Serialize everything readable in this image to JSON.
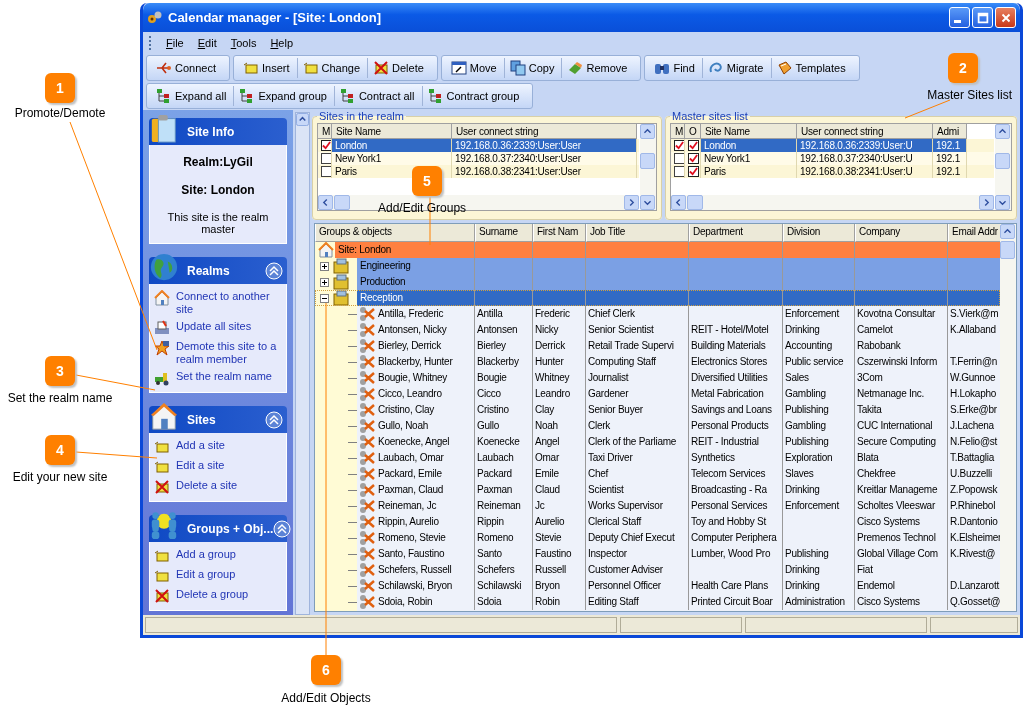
{
  "window": {
    "title": "Calendar manager - [Site: London]"
  },
  "menu": [
    "File",
    "Edit",
    "Tools",
    "Help"
  ],
  "toolbar_rows": [
    {
      "groups": [
        {
          "buttons": [
            "Connect"
          ]
        },
        {
          "buttons": [
            "Insert",
            "Change",
            "Delete"
          ]
        },
        {
          "buttons": [
            "Move",
            "Copy",
            "Remove"
          ]
        },
        {
          "buttons": [
            "Find",
            "Migrate",
            "Templates"
          ]
        }
      ]
    },
    {
      "groups": [
        {
          "buttons": [
            "Expand all",
            "Expand group",
            "Contract all",
            "Contract group"
          ]
        }
      ]
    }
  ],
  "task_pane": {
    "sections": [
      {
        "title": "Site Info",
        "kind": "info",
        "lines": [
          {
            "text": "Realm:LyGil",
            "kind": "bold"
          },
          {
            "text": "Site: London",
            "kind": "bold"
          },
          {
            "text": "This site is the realm master",
            "kind": "plain"
          }
        ]
      },
      {
        "title": "Realms",
        "kind": "links",
        "expanded": true,
        "links": [
          "Connect to another site",
          "Update all sites",
          "Demote this site to a realm member",
          "Set the realm name"
        ]
      },
      {
        "title": "Sites",
        "kind": "links",
        "expanded": true,
        "links": [
          "Add a site",
          "Edit a site",
          "Delete a site"
        ]
      },
      {
        "title": "Groups + Obj...",
        "kind": "links",
        "expanded": true,
        "links": [
          "Add a group",
          "Edit a group",
          "Delete a group"
        ]
      }
    ]
  },
  "sites_in_realm": {
    "title": "Sites in the realm",
    "columns": [
      "M",
      "Site Name",
      "User connect string"
    ],
    "rows": [
      {
        "master": true,
        "selected": true,
        "cells": [
          "",
          "London",
          "192.168.0.36:2339:User:User"
        ]
      },
      {
        "master": false,
        "selected": false,
        "cells": [
          "",
          "New York1",
          "192.168.0.37:2340:User:User"
        ]
      },
      {
        "master": false,
        "selected": false,
        "cells": [
          "",
          "Paris",
          "192.168.0.38:2341:User:User"
        ]
      }
    ]
  },
  "master_sites": {
    "title": "Master sites list",
    "columns": [
      "M",
      "O",
      "Site Name",
      "User connect string",
      "Admi"
    ],
    "rows": [
      {
        "m_checked": true,
        "o_checked": true,
        "selected": true,
        "cells": [
          "",
          "",
          "London",
          "192.168.0.36:2339:User:U",
          "192.1"
        ]
      },
      {
        "m_checked": false,
        "o_checked": true,
        "selected": false,
        "cells": [
          "",
          "",
          "New York1",
          "192.168.0.37:2340:User:U",
          "192.1"
        ]
      },
      {
        "m_checked": false,
        "o_checked": true,
        "selected": false,
        "cells": [
          "",
          "",
          "Paris",
          "192.168.0.38:2341:User:U",
          "192.1"
        ]
      }
    ]
  },
  "grid": {
    "columns": [
      "Groups & objects",
      "Surname",
      "First Nam",
      "Job Title",
      "Department",
      "Division",
      "Company",
      "Email Addr"
    ],
    "tree": {
      "label": "Site: London",
      "children": [
        {
          "label": "Engineering",
          "expanded": false,
          "selected": false
        },
        {
          "label": "Production",
          "expanded": false,
          "selected": false
        },
        {
          "label": "Reception",
          "expanded": true,
          "selected": true,
          "children": [
            {
              "label": "Antilla, Frederic",
              "cells": [
                "Antilla",
                "Frederic",
                "Chief Clerk",
                "",
                "Enforcement",
                "Kovotna Consultar",
                "S.Vierk@m"
              ]
            },
            {
              "label": "Antonsen, Nicky",
              "cells": [
                "Antonsen",
                "Nicky",
                "Senior Scientist",
                "REIT - Hotel/Motel",
                "Drinking",
                "Camelot",
                "K.Allaband"
              ]
            },
            {
              "label": "Bierley, Derrick",
              "cells": [
                "Bierley",
                "Derrick",
                "Retail Trade Supervi",
                "Building Materials",
                "Accounting",
                "Rabobank",
                ""
              ]
            },
            {
              "label": "Blackerby, Hunter",
              "cells": [
                "Blackerby",
                "Hunter",
                "Computing Staff",
                "Electronics Stores",
                "Public service",
                "Cszerwinski Inform",
                "T.Ferrin@n"
              ]
            },
            {
              "label": "Bougie, Whitney",
              "cells": [
                "Bougie",
                "Whitney",
                "Journalist",
                "Diversified Utilities",
                "Sales",
                "3Com",
                "W.Gunnoe"
              ]
            },
            {
              "label": "Cicco, Leandro",
              "cells": [
                "Cicco",
                "Leandro",
                "Gardener",
                "Metal Fabrication",
                "Gambling",
                "Netmanage Inc.",
                "H.Lokapho"
              ]
            },
            {
              "label": "Cristino, Clay",
              "cells": [
                "Cristino",
                "Clay",
                "Senior Buyer",
                "Savings and Loans",
                "Publishing",
                "Takita",
                "S.Erke@br"
              ]
            },
            {
              "label": "Gullo, Noah",
              "cells": [
                "Gullo",
                "Noah",
                "Clerk",
                "Personal Products",
                "Gambling",
                "CUC International",
                "J.Lachena"
              ]
            },
            {
              "label": "Koenecke, Angel",
              "cells": [
                "Koenecke",
                "Angel",
                "Clerk of the Parliame",
                "REIT - Industrial",
                "Publishing",
                "Secure Computing",
                "N.Felio@st"
              ]
            },
            {
              "label": "Laubach, Omar",
              "cells": [
                "Laubach",
                "Omar",
                "Taxi Driver",
                "Synthetics",
                "Exploration",
                "Blata",
                "T.Battaglia"
              ]
            },
            {
              "label": "Packard, Emile",
              "cells": [
                "Packard",
                "Emile",
                "Chef",
                "Telecom Services",
                "Slaves",
                "Chekfree",
                "U.Buzzelli"
              ]
            },
            {
              "label": "Paxman, Claud",
              "cells": [
                "Paxman",
                "Claud",
                "Scientist",
                "Broadcasting - Ra",
                "Drinking",
                "Kreitlar Manageme",
                "Z.Popowsk"
              ]
            },
            {
              "label": "Reineman, Jc",
              "cells": [
                "Reineman",
                "Jc",
                "Works Supervisor",
                "Personal Services",
                "Enforcement",
                "Scholtes Vleeswar",
                "P.Rhinebol"
              ]
            },
            {
              "label": "Rippin, Aurelio",
              "cells": [
                "Rippin",
                "Aurelio",
                "Clerical Staff",
                "Toy and Hobby St",
                "",
                "Cisco Systems",
                "R.Dantonio"
              ]
            },
            {
              "label": "Romeno, Stevie",
              "cells": [
                "Romeno",
                "Stevie",
                "Deputy Chief Execut",
                "Computer Periphera",
                "",
                "Premenos Technol",
                "K.Elsheimer"
              ]
            },
            {
              "label": "Santo, Faustino",
              "cells": [
                "Santo",
                "Faustino",
                "Inspector",
                "Lumber, Wood Pro",
                "Publishing",
                "Global Village Com",
                "K.Rivest@"
              ]
            },
            {
              "label": "Schefers, Russell",
              "cells": [
                "Schefers",
                "Russell",
                "Customer Adviser",
                "",
                "Drinking",
                "Fiat",
                ""
              ]
            },
            {
              "label": "Schilawski, Bryon",
              "cells": [
                "Schilawski",
                "Bryon",
                "Personnel Officer",
                "Health Care Plans",
                "Drinking",
                "Endemol",
                "D.Lanzarott"
              ]
            },
            {
              "label": "Sdoia, Robin",
              "cells": [
                "Sdoia",
                "Robin",
                "Editing Staff",
                "Printed Circuit Boar",
                "Administration",
                "Cisco Systems",
                "Q.Gosset@"
              ]
            }
          ]
        }
      ]
    }
  },
  "callouts": [
    {
      "number": "1",
      "label": "Promote/Demote"
    },
    {
      "number": "2",
      "label": "Master Sites list"
    },
    {
      "number": "3",
      "label": "Set the realm name"
    },
    {
      "number": "4",
      "label": "Edit your new site"
    },
    {
      "number": "5",
      "label": "Add/Edit Groups"
    },
    {
      "number": "6",
      "label": "Add/Edit Objects"
    }
  ]
}
